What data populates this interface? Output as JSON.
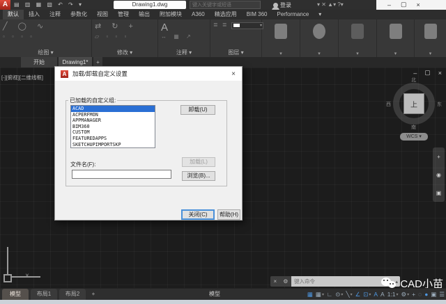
{
  "icons": {
    "caret_down": "▾",
    "caret_up": "▴",
    "prompt_arrow": "▸",
    "close": "×",
    "minimize": "–",
    "maximize": "▢",
    "wrench": "⚙",
    "qat_glyphs": "▤ ▥ ▦ ▧ ↶ ↷ ▾",
    "draw_glyphs": "╱ ◯ ∿",
    "draw_grid": "▫ ▫ ▫ ▫",
    "modify_glyphs": "⇄ ↻ +",
    "modify_grid": "▱ ▫ ▫ ▫",
    "annotate_big": "A",
    "annotate_small": "↔ ▦ ↗",
    "layer_glyphs": "≣ ≣ ≣",
    "nav_glyphs": [
      "+",
      "◉",
      "▣"
    ],
    "crosshair": "×"
  },
  "title_bar": {
    "app_initial": "A",
    "document_title": "Drawing1.dwg",
    "search_placeholder": "键入关键字或短语",
    "sign_in": "登录",
    "extra_icons": "▾  ✕  ▲▾  ?▾"
  },
  "ribbon": {
    "tabs": [
      {
        "label": "默认"
      },
      {
        "label": "插入"
      },
      {
        "label": "注释"
      },
      {
        "label": "参数化"
      },
      {
        "label": "视图"
      },
      {
        "label": "管理"
      },
      {
        "label": "输出"
      },
      {
        "label": "附加模块"
      },
      {
        "label": "A360"
      },
      {
        "label": "精选应用"
      },
      {
        "label": "BIM 360"
      },
      {
        "label": "Performance"
      }
    ],
    "active_tab": "默认",
    "panels": [
      {
        "label": "绘图"
      },
      {
        "label": "修改"
      },
      {
        "label": "注释"
      },
      {
        "label": "图层"
      }
    ]
  },
  "file_tabs": {
    "start": "开始",
    "drawing": "Drawing1*",
    "new_tab": "+"
  },
  "viewport": {
    "label": "[-][俯视][二维线框]",
    "viewcube": {
      "north": "北",
      "south": "南",
      "west": "西",
      "east": "东",
      "top_face": "上",
      "wcs": "WCS ▾"
    }
  },
  "dialog": {
    "title": "加载/卸载自定义设置",
    "group_label": "已加载的自定义组:",
    "groups": [
      "ACAD",
      "ACPERFMON",
      "APPMANAGER",
      "BIM360",
      "CUSTOM",
      "FEATUREDAPPS",
      "SKETCHUPIMPORTSKP"
    ],
    "selected_group": "ACAD",
    "unload_button": "卸载(U)",
    "file_name_label": "文件名(F):",
    "file_name_value": "",
    "load_button": "加载(L)",
    "browse_button": "浏览(B)...",
    "close_button": "关闭(C)",
    "help_button": "帮助(H)"
  },
  "command_line": {
    "placeholder": "键入命令",
    "close_glyph": "×",
    "wrench_glyph": "⚙"
  },
  "status_bar": {
    "model_tab": "模型",
    "layout1_tab": "布局1",
    "layout2_tab": "布局2",
    "add_layout": "+",
    "model_label": "模型",
    "annotation_scale": "1:1",
    "icons": [
      {
        "name": "grid",
        "glyph": "▦",
        "active": true
      },
      {
        "name": "snap",
        "glyph": "▦",
        "active": false
      },
      {
        "name": "ortho",
        "glyph": "∟",
        "active": false
      },
      {
        "name": "polar-tracking",
        "glyph": "⊙",
        "active": false
      },
      {
        "name": "isodraft",
        "glyph": "╲",
        "active": false
      },
      {
        "name": "object-snap-tracking",
        "glyph": "∠",
        "active": true
      },
      {
        "name": "object-snap",
        "glyph": "⊡",
        "active": true
      },
      {
        "name": "annotation-visibility",
        "glyph": "A",
        "active": true
      },
      {
        "name": "auto-scale",
        "glyph": "A",
        "active": false
      },
      {
        "name": "workspace",
        "glyph": "⚙",
        "active": false
      },
      {
        "name": "annotation-monitor",
        "glyph": "+",
        "active": false
      },
      {
        "name": "isolate-objects",
        "glyph": "◌",
        "active": false
      },
      {
        "name": "hardware-acceleration",
        "glyph": "●",
        "active": true
      },
      {
        "name": "clean-screen",
        "glyph": "▣",
        "active": false
      },
      {
        "name": "customize",
        "glyph": "☰",
        "active": false
      }
    ]
  },
  "watermark": {
    "text": "CAD小苗"
  },
  "colors": {
    "selection_blue": "#2a6fd4",
    "autocad_red": "#c03022",
    "status_active_blue": "#4d96e0",
    "canvas_bg": "#1c1c1c",
    "dialog_bg": "#f0f0f0"
  }
}
